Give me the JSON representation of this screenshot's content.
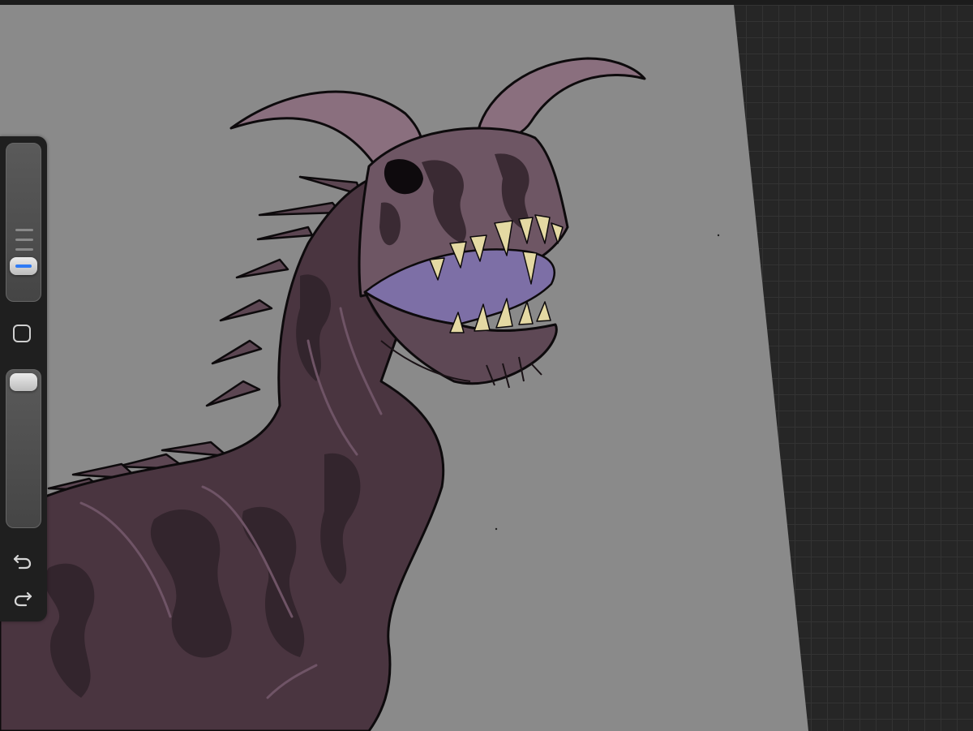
{
  "app": {
    "screen": "drawing-canvas"
  },
  "toolbar": {
    "brush_size": {
      "value": 0.22
    },
    "brush_opacity": {
      "value": 1.0
    },
    "modifier_button": {
      "icon": "square-icon"
    },
    "undo_button": {
      "icon": "undo-arrow-icon"
    },
    "redo_button": {
      "icon": "redo-arrow-icon"
    }
  },
  "colors": {
    "canvas": "#8a8a8a",
    "workspace": "#262626",
    "accent": "#2f7bf5",
    "creature_body": "#4a3540",
    "creature_light": "#8a6f7e",
    "mouth": "#7d6fa6",
    "teeth": "#e4d9a3"
  },
  "artwork": {
    "subject": "horned-creature-illustration"
  }
}
